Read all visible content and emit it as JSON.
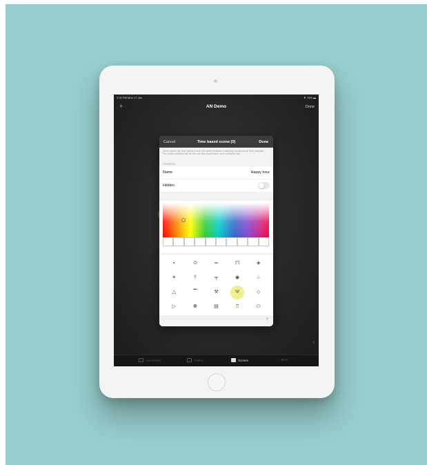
{
  "status_bar": {
    "time": "3:32 PM  Mon 17 Jan",
    "battery": "▼ 76% ▬"
  },
  "nav": {
    "add_label": "+",
    "title": "AN Demo",
    "done_label": "Done"
  },
  "modal": {
    "cancel_label": "Cancel",
    "title": "Time based scene [0]",
    "done_label": "Done",
    "description": "When active the time based scene will switch between matching conditions as time changes. The initial condition will be the one that would have been activated last.",
    "section_label": "GENERAL",
    "name_label": "Name",
    "name_value": "Happy hour",
    "hidden_label": "Hidden",
    "hidden_on": false,
    "help_label": "?",
    "icons": [
      {
        "name": "tv-icon",
        "glyph": "▪"
      },
      {
        "name": "lamp-icon",
        "glyph": "⊙"
      },
      {
        "name": "bed-icon",
        "glyph": "═"
      },
      {
        "name": "network-icon",
        "glyph": "⨅"
      },
      {
        "name": "speaker-icon",
        "glyph": "◈"
      },
      {
        "name": "sun-icon",
        "glyph": "☀"
      },
      {
        "name": "spotlight-icon",
        "glyph": "†"
      },
      {
        "name": "chandelier-icon",
        "glyph": "╤"
      },
      {
        "name": "eye-icon",
        "glyph": "◉"
      },
      {
        "name": "walk-icon",
        "glyph": "♧"
      },
      {
        "name": "hanger-icon",
        "glyph": "△"
      },
      {
        "name": "chart-icon",
        "glyph": "▔"
      },
      {
        "name": "tools-icon",
        "glyph": "⚒"
      },
      {
        "name": "cocktail-icon",
        "glyph": "Ψ"
      },
      {
        "name": "cube-icon",
        "glyph": "◇"
      },
      {
        "name": "fish-icon",
        "glyph": "▷"
      },
      {
        "name": "bike-icon",
        "glyph": "☸"
      },
      {
        "name": "armchair-icon",
        "glyph": "▤"
      },
      {
        "name": "bank-icon",
        "glyph": "♖"
      },
      {
        "name": "ball-icon",
        "glyph": "⬭"
      }
    ],
    "selected_icon": "cocktail-icon"
  },
  "tabbar": {
    "items": [
      "Luminaires",
      "Gallery",
      "Scenes",
      "More"
    ],
    "active": "Scenes"
  },
  "corner_help": "?",
  "colors": {
    "backdrop": "#97cdcc",
    "tablet": "#f4f4f2",
    "screen": "#262626",
    "selected_icon_bg": "#f2f08a"
  }
}
